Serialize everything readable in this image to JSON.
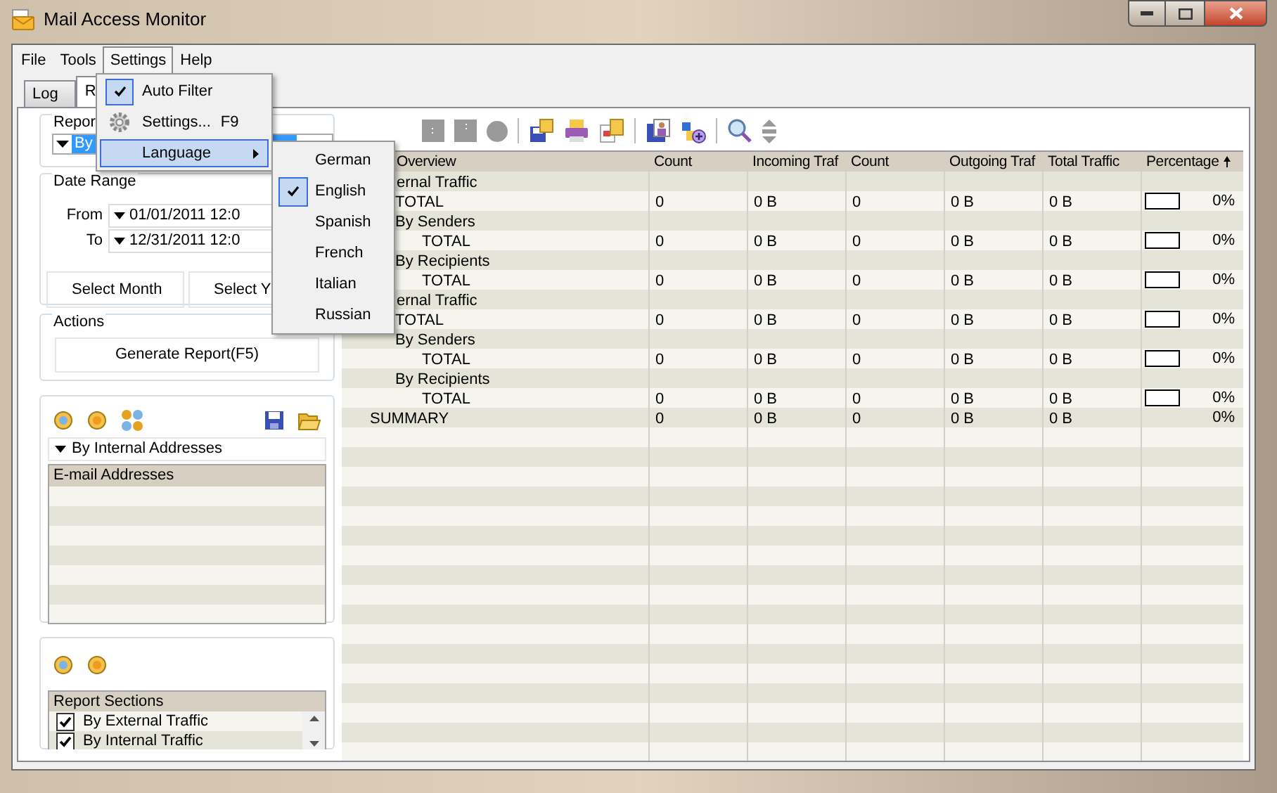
{
  "window": {
    "title": "Mail Access Monitor"
  },
  "menu_bar": [
    {
      "label": "File",
      "selected": false
    },
    {
      "label": "Tools",
      "selected": false
    },
    {
      "label": "Settings",
      "selected": true
    },
    {
      "label": "Help",
      "selected": false
    }
  ],
  "settings_menu": [
    {
      "kind": "check",
      "label": "Auto Filter",
      "checked": true,
      "selected": false
    },
    {
      "kind": "command",
      "label": "Settings...",
      "shortcut": "F9",
      "checked": false,
      "selected": false
    },
    {
      "kind": "submenu",
      "label": "Language",
      "checked": false,
      "selected": true
    }
  ],
  "language_menu": [
    {
      "label": "German",
      "checked": false
    },
    {
      "label": "English",
      "checked": true
    },
    {
      "label": "Spanish",
      "checked": false
    },
    {
      "label": "French",
      "checked": false
    },
    {
      "label": "Italian",
      "checked": false
    },
    {
      "label": "Russian",
      "checked": false
    }
  ],
  "tabs": [
    {
      "label": "Log",
      "selected": false
    },
    {
      "label": "R",
      "selected": true
    }
  ],
  "report_group": {
    "legend": "Repor",
    "combo_value": "By"
  },
  "date_range": {
    "legend": "Date Range",
    "from_label": "From",
    "from_value": "01/01/2011 12:0",
    "to_label": "To",
    "to_value": "12/31/2011 12:0",
    "buttons": [
      "Select Month",
      "Select Y"
    ]
  },
  "actions": {
    "legend": "Actions",
    "button": "Generate Report(F5)"
  },
  "addresses": {
    "filter": "By Internal Addresses",
    "column": "E-mail Addresses"
  },
  "sections": {
    "column": "Report Sections",
    "items": [
      {
        "label": "By External Traffic",
        "checked": true
      },
      {
        "label": "By Internal Traffic",
        "checked": true
      }
    ]
  },
  "table": {
    "columns": [
      {
        "label": "Overview",
        "sorted": false
      },
      {
        "label": "Count",
        "sorted": false
      },
      {
        "label": "Incoming Traf",
        "sorted": false
      },
      {
        "label": "Count",
        "sorted": false
      },
      {
        "label": "Outgoing Traf",
        "sorted": false
      },
      {
        "label": "Total Traffic",
        "sorted": false
      },
      {
        "label": "Percentage",
        "sorted": true
      }
    ],
    "rows": [
      {
        "label": "ernal Traffic",
        "cut": true,
        "children": [
          {
            "label": "TOTAL",
            "cells": [
              "0",
              "0 B",
              "0",
              "0 B",
              "0 B"
            ],
            "bar": true,
            "percent": "0%"
          },
          {
            "label": "By Senders",
            "children": [
              {
                "label": "TOTAL",
                "cells": [
                  "0",
                  "0 B",
                  "0",
                  "0 B",
                  "0 B"
                ],
                "bar": true,
                "percent": "0%"
              }
            ]
          },
          {
            "label": "By Recipients",
            "children": [
              {
                "label": "TOTAL",
                "cells": [
                  "0",
                  "0 B",
                  "0",
                  "0 B",
                  "0 B"
                ],
                "bar": true,
                "percent": "0%"
              }
            ]
          }
        ]
      },
      {
        "label": "ernal Traffic",
        "cut": true,
        "children": [
          {
            "label": "TOTAL",
            "cells": [
              "0",
              "0 B",
              "0",
              "0 B",
              "0 B"
            ],
            "bar": true,
            "percent": "0%"
          },
          {
            "label": "By Senders",
            "children": [
              {
                "label": "TOTAL",
                "cells": [
                  "0",
                  "0 B",
                  "0",
                  "0 B",
                  "0 B"
                ],
                "bar": true,
                "percent": "0%"
              }
            ]
          },
          {
            "label": "By Recipients",
            "children": [
              {
                "label": "TOTAL",
                "cells": [
                  "0",
                  "0 B",
                  "0",
                  "0 B",
                  "0 B"
                ],
                "bar": true,
                "percent": "0%"
              }
            ]
          }
        ]
      },
      {
        "label": "SUMMARY",
        "cells": [
          "0",
          "0 B",
          "0",
          "0 B",
          "0 B"
        ],
        "percent": "0%"
      }
    ]
  }
}
